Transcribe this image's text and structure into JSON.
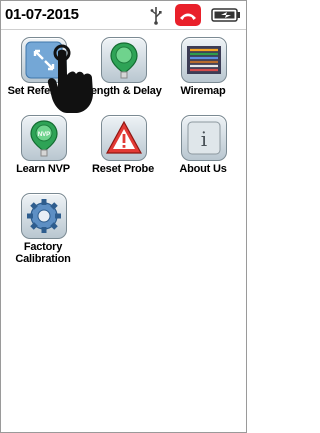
{
  "status_bar": {
    "date": "01-07-2015",
    "icons": [
      "usb-icon",
      "end-call-icon",
      "battery-icon"
    ],
    "colors": {
      "end_call": "#e9202a"
    }
  },
  "apps": [
    {
      "id": "set-reference",
      "label": "Set Reference",
      "icon": "set-reference-icon"
    },
    {
      "id": "length-delay",
      "label": "Length & Delay",
      "icon": "length-delay-icon"
    },
    {
      "id": "wiremap",
      "label": "Wiremap",
      "icon": "wiremap-icon"
    },
    {
      "id": "learn-nvp",
      "label": "Learn NVP",
      "icon": "learn-nvp-icon",
      "badge": "NVP"
    },
    {
      "id": "reset-probe",
      "label": "Reset Probe",
      "icon": "reset-probe-icon"
    },
    {
      "id": "about-us",
      "label": "About Us",
      "icon": "about-us-icon",
      "glyph": "i"
    },
    {
      "id": "factory-calibration",
      "label": "Factory Calibration",
      "icon": "factory-calibration-icon"
    }
  ],
  "overlay": {
    "icon": "touch-hand-icon"
  }
}
